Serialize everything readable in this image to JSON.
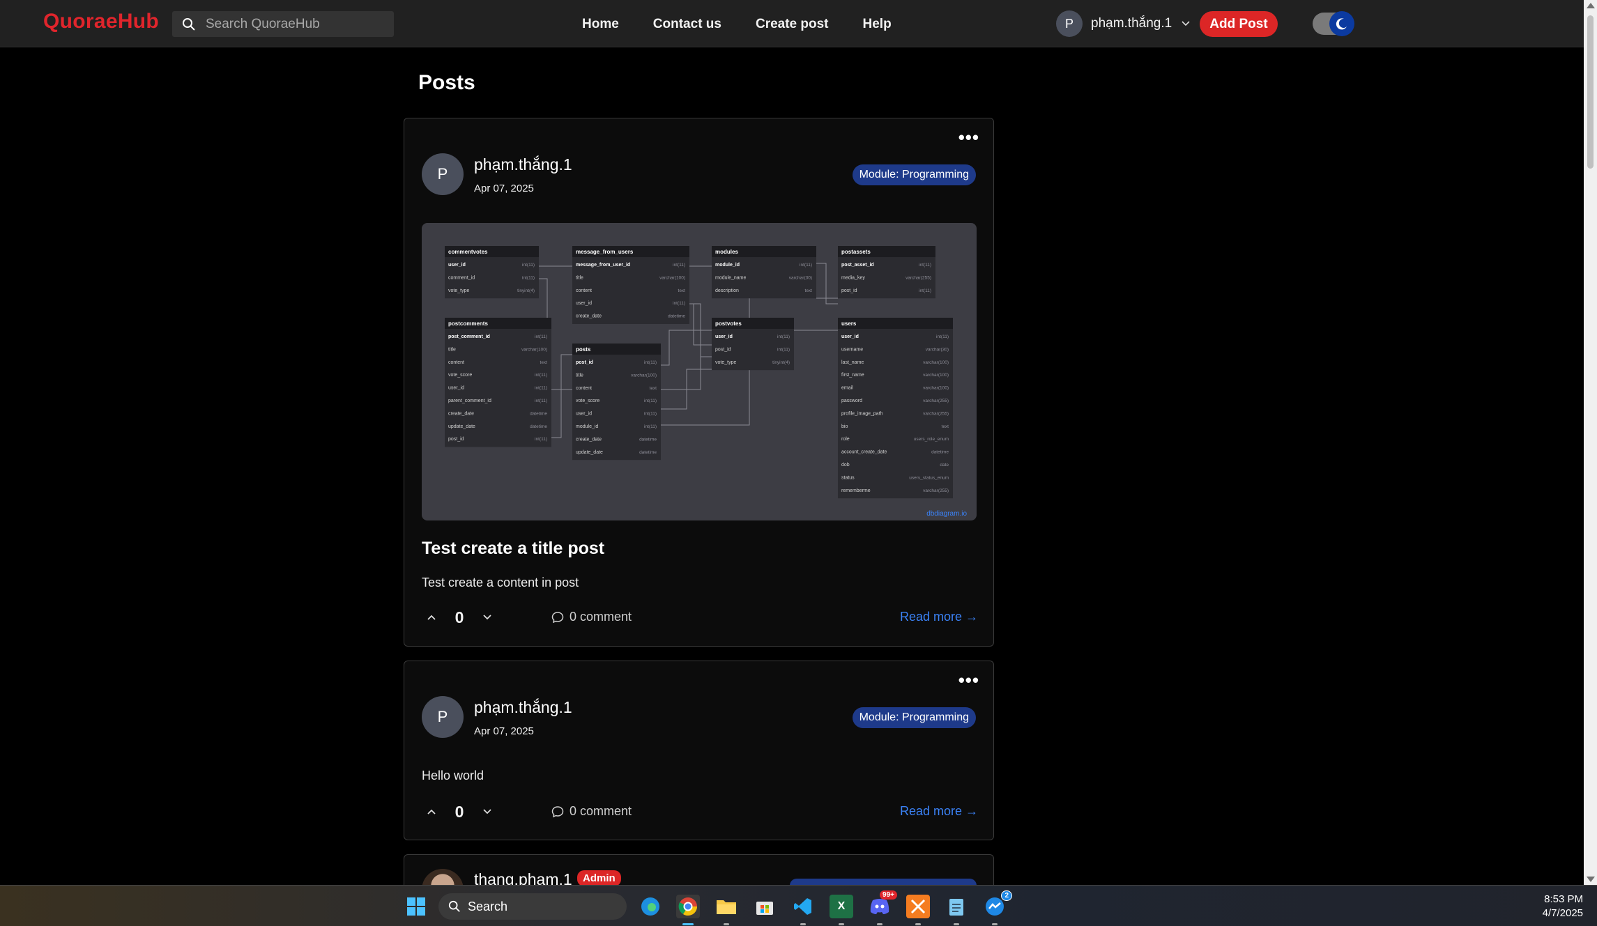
{
  "nav": {
    "logo": "QuoraeHub",
    "search_placeholder": "Search QuoraeHub",
    "links": [
      "Home",
      "Contact us",
      "Create post",
      "Help"
    ],
    "user_initial": "P",
    "username": "phạm.thắng.1",
    "add_post": "Add Post"
  },
  "page_title": "Posts",
  "posts": [
    {
      "initial": "P",
      "author": "phạm.thắng.1",
      "date": "Apr 07, 2025",
      "module": "Module: Programming",
      "title": "Test create a title post",
      "content": "Test create a content in post",
      "votes": "0",
      "comments": "0 comment",
      "read_more": "Read more →"
    },
    {
      "initial": "P",
      "author": "phạm.thắng.1",
      "date": "Apr 07, 2025",
      "module": "Module: Programming",
      "content": "Hello world",
      "votes": "0",
      "comments": "0 comment",
      "read_more": "Read more →"
    },
    {
      "author": "thang.pham.1",
      "role_badge": "Admin"
    }
  ],
  "diagram": {
    "watermark": "dbdiagram.io",
    "tables": [
      {
        "name": "commentvotes",
        "rows": [
          [
            "user_id",
            "int(11)"
          ],
          [
            "comment_id",
            "int(11)"
          ],
          [
            "vote_type",
            "tinyint(4)"
          ]
        ]
      },
      {
        "name": "message_from_users",
        "rows": [
          [
            "message_from_user_id",
            "int(11)"
          ],
          [
            "title",
            "varchar(100)"
          ],
          [
            "content",
            "text"
          ],
          [
            "user_id",
            "int(11)"
          ],
          [
            "create_date",
            "datetime"
          ]
        ]
      },
      {
        "name": "modules",
        "rows": [
          [
            "module_id",
            "int(11)"
          ],
          [
            "module_name",
            "varchar(30)"
          ],
          [
            "description",
            "text"
          ]
        ]
      },
      {
        "name": "postassets",
        "rows": [
          [
            "post_asset_id",
            "int(11)"
          ],
          [
            "media_key",
            "varchar(255)"
          ],
          [
            "post_id",
            "int(11)"
          ]
        ]
      },
      {
        "name": "postcomments",
        "rows": [
          [
            "post_comment_id",
            "int(11)"
          ],
          [
            "title",
            "varchar(100)"
          ],
          [
            "content",
            "text"
          ],
          [
            "vote_score",
            "int(11)"
          ],
          [
            "user_id",
            "int(11)"
          ],
          [
            "parent_comment_id",
            "int(11)"
          ],
          [
            "create_date",
            "datetime"
          ],
          [
            "update_date",
            "datetime"
          ],
          [
            "post_id",
            "int(11)"
          ]
        ]
      },
      {
        "name": "posts",
        "rows": [
          [
            "post_id",
            "int(11)"
          ],
          [
            "title",
            "varchar(100)"
          ],
          [
            "content",
            "text"
          ],
          [
            "vote_score",
            "int(11)"
          ],
          [
            "user_id",
            "int(11)"
          ],
          [
            "module_id",
            "int(11)"
          ],
          [
            "create_date",
            "datetime"
          ],
          [
            "update_date",
            "datetime"
          ]
        ]
      },
      {
        "name": "postvotes",
        "rows": [
          [
            "user_id",
            "int(11)"
          ],
          [
            "post_id",
            "int(11)"
          ],
          [
            "vote_type",
            "tinyint(4)"
          ]
        ]
      },
      {
        "name": "users",
        "rows": [
          [
            "user_id",
            "int(11)"
          ],
          [
            "username",
            "varchar(30)"
          ],
          [
            "last_name",
            "varchar(100)"
          ],
          [
            "first_name",
            "varchar(100)"
          ],
          [
            "email",
            "varchar(100)"
          ],
          [
            "password",
            "varchar(255)"
          ],
          [
            "profile_image_path",
            "varchar(255)"
          ],
          [
            "bio",
            "text"
          ],
          [
            "role",
            "users_role_enum"
          ],
          [
            "account_create_date",
            "datetime"
          ],
          [
            "dob",
            "date"
          ],
          [
            "status",
            "users_status_enum"
          ],
          [
            "rememberme",
            "varchar(255)"
          ]
        ]
      }
    ]
  },
  "taskbar": {
    "search": "Search",
    "time": "8:53 PM",
    "date": "4/7/2025",
    "discord_badge": "99+",
    "messenger_badge": "2"
  },
  "colors": {
    "brand": "#e0252c",
    "module_badge": "#1e3a8a",
    "link": "#3b82f6"
  }
}
